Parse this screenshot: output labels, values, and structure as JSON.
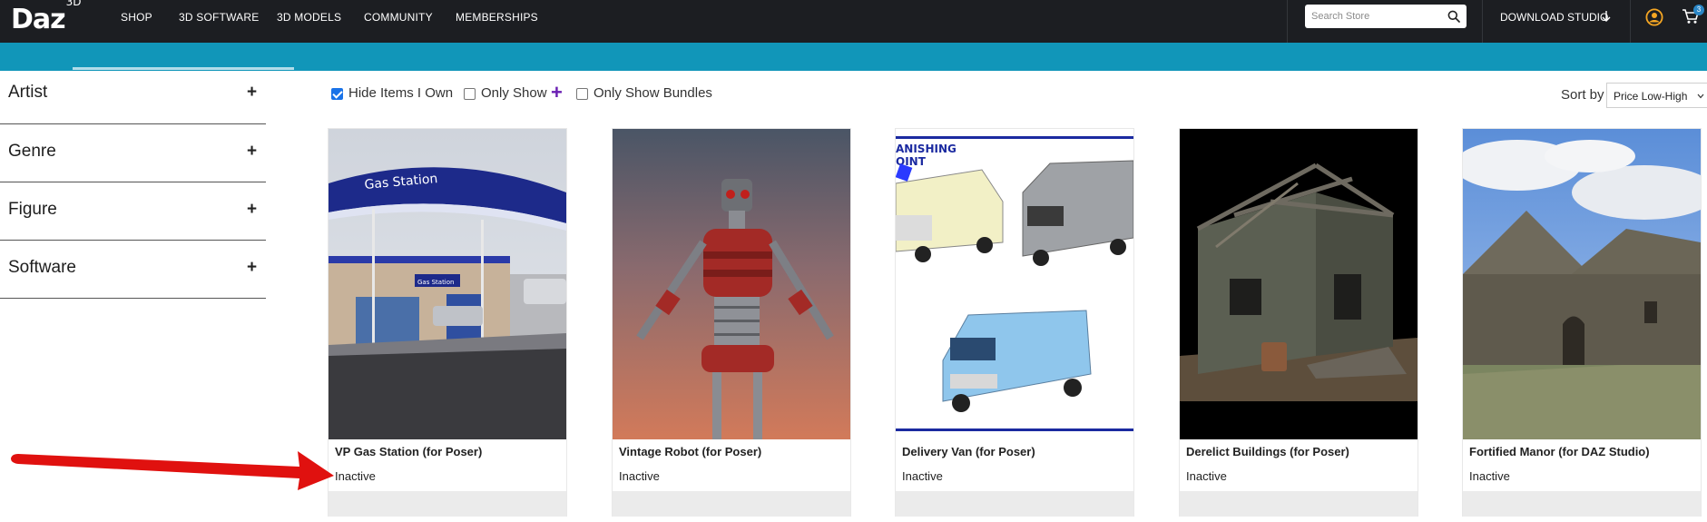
{
  "header": {
    "logo_text": "Daz",
    "logo_sup": "3D",
    "nav": [
      {
        "label": "SHOP"
      },
      {
        "label": "3D SOFTWARE"
      },
      {
        "label": "3D MODELS"
      },
      {
        "label": "COMMUNITY"
      },
      {
        "label": "MEMBERSHIPS"
      }
    ],
    "search_placeholder": "Search Store",
    "download_label": "DOWNLOAD STUDIO",
    "cart_count": "3",
    "icons": [
      "search-icon",
      "download-arrow-icon",
      "user-icon",
      "cart-icon"
    ],
    "brand_color": "#1196b9"
  },
  "sidebar": {
    "filters": [
      {
        "label": "Artist",
        "toggle": "+"
      },
      {
        "label": "Genre",
        "toggle": "+"
      },
      {
        "label": "Figure",
        "toggle": "+"
      },
      {
        "label": "Software",
        "toggle": "+"
      }
    ]
  },
  "toolbar": {
    "hide_owned": {
      "label": "Hide Items I Own",
      "checked": true
    },
    "only_show": {
      "label": "Only Show",
      "checked": false,
      "badge": "+"
    },
    "only_bundles": {
      "label": "Only Show Bundles",
      "checked": false
    },
    "sort_label": "Sort by",
    "sort_value": "Price Low-High"
  },
  "products": [
    {
      "title": "VP Gas Station (for Poser)",
      "status": "Inactive",
      "image_sign": "Gas Station",
      "small_sign": "Gas Station"
    },
    {
      "title": "Vintage Robot (for Poser)",
      "status": "Inactive"
    },
    {
      "title": "Delivery Van (for Poser)",
      "status": "Inactive",
      "image_banner": "VANISHING\nPOINT"
    },
    {
      "title": "Derelict Buildings (for Poser)",
      "status": "Inactive"
    },
    {
      "title": "Fortified Manor (for DAZ Studio)",
      "status": "Inactive"
    }
  ]
}
